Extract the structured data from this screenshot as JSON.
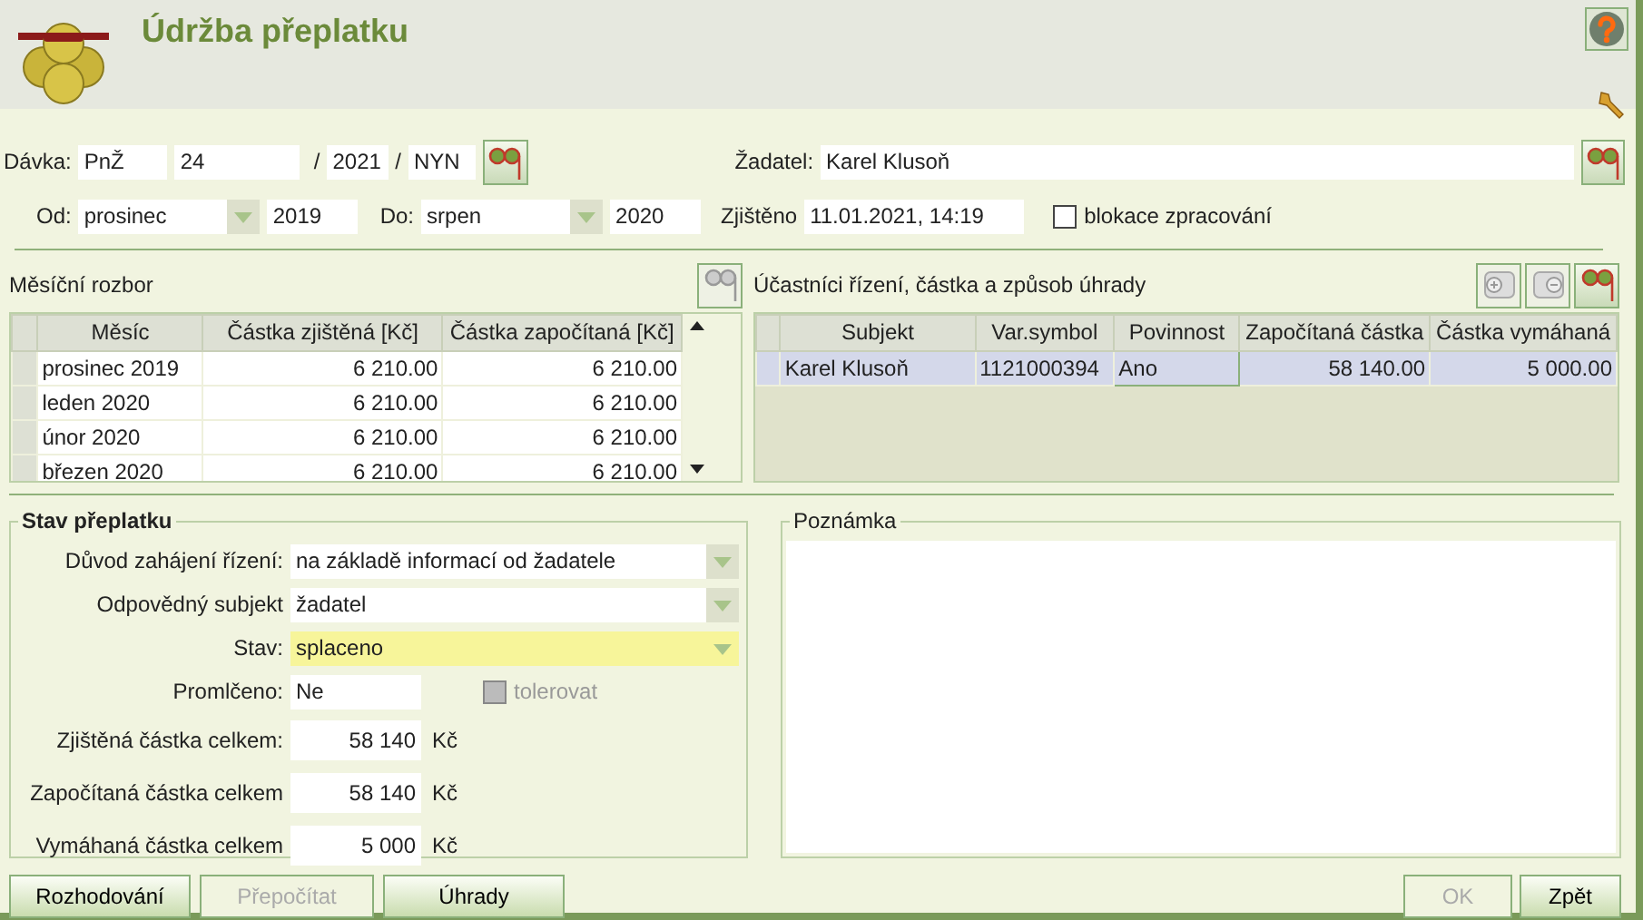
{
  "window": {
    "title": "Údržba přeplatku"
  },
  "batch": {
    "label": "Dávka:",
    "prefix": "PnŽ",
    "number": "24",
    "sep1": "/",
    "year": "2021",
    "sep2": "/",
    "code": "NYN"
  },
  "applicant": {
    "label": "Žadatel:",
    "value": "Karel Klusoň"
  },
  "period_from": {
    "label": "Od:",
    "month": "prosinec",
    "year": "2019"
  },
  "period_to": {
    "label": "Do:",
    "month": "srpen",
    "year": "2020"
  },
  "detected": {
    "label": "Zjištěno",
    "value": "11.01.2021, 14:19"
  },
  "blocking": {
    "label": "blokace zpracování",
    "checked": false
  },
  "monthly": {
    "title": "Měsíční rozbor",
    "view_disabled": true,
    "columns": [
      "Měsíc",
      "Částka zjištěná [Kč]",
      "Částka započítaná [Kč]"
    ],
    "rows": [
      {
        "cells": [
          "prosinec 2019",
          "6 210.00",
          "6 210.00"
        ]
      },
      {
        "cells": [
          "leden 2020",
          "6 210.00",
          "6 210.00"
        ]
      },
      {
        "cells": [
          "únor 2020",
          "6 210.00",
          "6 210.00"
        ]
      },
      {
        "cells": [
          "březen 2020",
          "6 210.00",
          "6 210.00"
        ]
      }
    ]
  },
  "participants": {
    "title": "Účastníci řízení, částka a způsob úhrady",
    "tools": [
      {
        "kind": "add",
        "disabled": true
      },
      {
        "kind": "remove",
        "disabled": true
      },
      {
        "kind": "view",
        "disabled": false
      }
    ],
    "columns": [
      "Subjekt",
      "Var.symbol",
      "Povinnost",
      "Započítaná částka",
      "Částka vymáhaná"
    ],
    "rows": [
      {
        "cells": [
          "Karel Klusoň",
          "1121000394",
          "Ano",
          "58 140.00",
          "5 000.00"
        ],
        "selected": true
      }
    ]
  },
  "status": {
    "title": "Stav přeplatku",
    "fields": [
      {
        "kind": "select",
        "label": "Důvod zahájení řízení:",
        "value": "na základě informací od žadatele",
        "highlighted": false
      },
      {
        "kind": "select",
        "label": "Odpovědný subjekt",
        "value": "žadatel",
        "highlighted": false
      },
      {
        "kind": "select",
        "label": "Stav:",
        "value": "splaceno",
        "highlighted": true
      },
      {
        "kind": "flag",
        "label": "Promlčeno:",
        "value": "Ne",
        "check_label": "tolerovat",
        "checked": false,
        "disabled": true
      },
      {
        "kind": "amount",
        "label": "Zjištěná částka celkem:",
        "value": "58 140",
        "unit": "Kč"
      },
      {
        "kind": "amount",
        "label": "Započítaná částka celkem",
        "value": "58 140",
        "unit": "Kč"
      },
      {
        "kind": "amount",
        "label": "Vymáhaná částka celkem",
        "value": "5 000",
        "unit": "Kč"
      }
    ]
  },
  "note": {
    "title": "Poznámka"
  },
  "left_buttons": [
    {
      "label": "Rozhodování",
      "disabled": false
    },
    {
      "label": "Přepočítat",
      "disabled": true
    },
    {
      "label": "Úhrady",
      "disabled": false
    }
  ],
  "right_buttons": [
    {
      "label": "OK",
      "disabled": true
    },
    {
      "label": "Zpět",
      "disabled": false
    }
  ]
}
